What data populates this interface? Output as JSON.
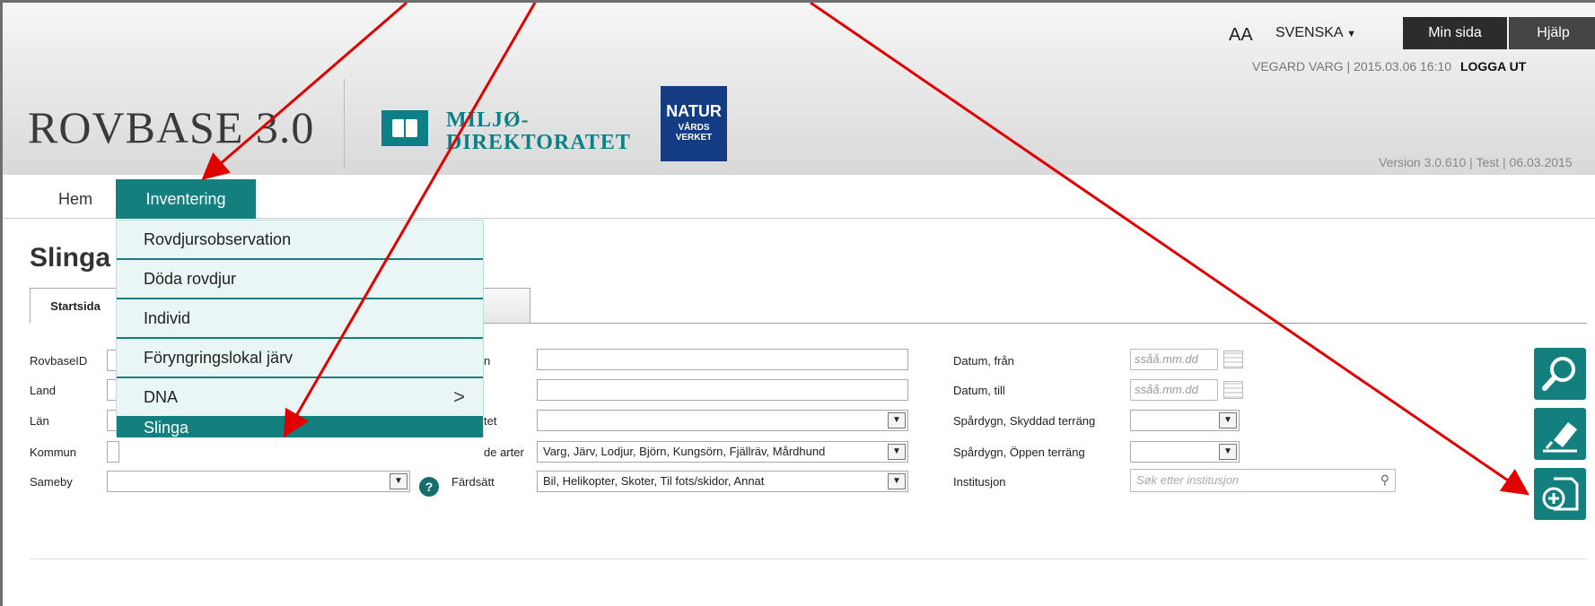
{
  "header": {
    "brand": "ROVBASE 3.0",
    "partner1_line1": "MILJØ-",
    "partner1_line2": "DIREKTORATET",
    "partner2_line1": "NATUR",
    "partner2_line2": "VÅRDS",
    "partner2_line3": "VERKET",
    "font_size_toggle": "AA",
    "language": "SVENSKA",
    "my_page_button": "Min sida",
    "help_button": "Hjälp",
    "user_info": "VEGARD VARG | 2015.03.06 16:10",
    "logout": "LOGGA UT",
    "version": "Version 3.0.610 | Test | 06.03.2015"
  },
  "nav": {
    "home": "Hem",
    "inventory": "Inventering"
  },
  "menu": {
    "items": [
      {
        "label": "Rovdjursobservation"
      },
      {
        "label": "Döda rovdjur"
      },
      {
        "label": "Individ"
      },
      {
        "label": "Föryngringslokal järv"
      },
      {
        "label": "DNA",
        "has_submenu": true,
        "chevron": ">"
      },
      {
        "label": "Slinga",
        "active": true
      }
    ]
  },
  "page": {
    "title": "Slinga",
    "tab_start": "Startsida"
  },
  "form": {
    "rovbaseid_label": "RovbaseID",
    "land_label": "Land",
    "lan_label": "Län",
    "kommun_label": "Kommun",
    "sameby_label": "Sameby",
    "col2_label1": "n",
    "col2_label3": "tet",
    "col2_label4": "de arter",
    "col2_label5": "Färdsätt",
    "species_value": "Varg, Järv, Lodjur, Björn, Kungsörn, Fjällräv, Mårdhund",
    "travel_value": "Bil, Helikopter, Skoter, Til fots/skidor, Annat",
    "date_from_label": "Datum, från",
    "date_to_label": "Datum, till",
    "date_placeholder": "ssåå.mm.dd",
    "track_protected_label": "Spårdygn, Skyddad terräng",
    "track_open_label": "Spårdygn, Öppen terräng",
    "institution_label": "Institusjon",
    "institution_placeholder": "Søk etter institusjon"
  },
  "colors": {
    "accent": "#13807f",
    "annotation_arrow": "#e00000"
  },
  "icons": {
    "search_button": "search-icon",
    "clear_button": "eraser-icon",
    "new_button": "add-document-icon"
  }
}
